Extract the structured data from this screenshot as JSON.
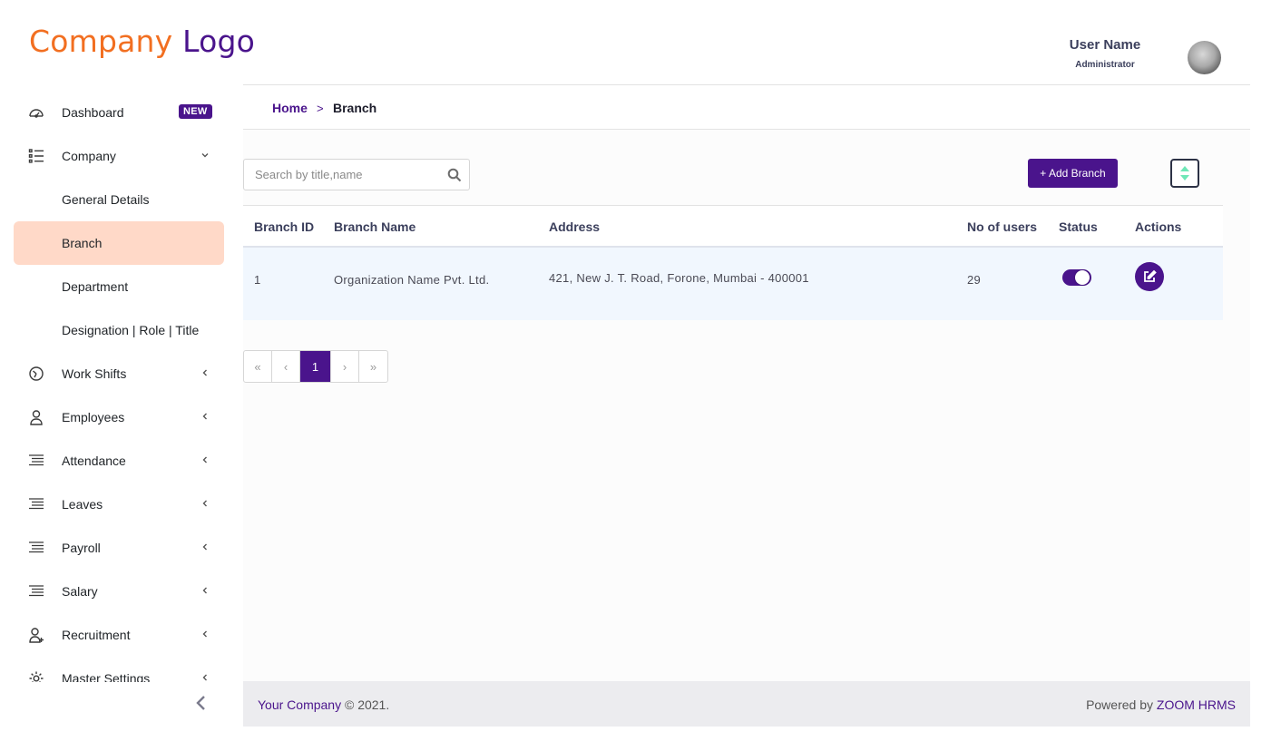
{
  "logo": {
    "part1": "Company",
    "part2": "Logo"
  },
  "user": {
    "name": "User Name",
    "role": "Administrator"
  },
  "colors": {
    "primary": "#4a148c",
    "accent": "#f26f21",
    "active_nav": "#ffd9c8"
  },
  "sidebar": {
    "items": [
      {
        "label": "Dashboard",
        "icon": "dashboard-icon",
        "badge": "NEW"
      },
      {
        "label": "Company",
        "icon": "list-icon",
        "chevron": "chevron-down-icon"
      },
      {
        "label": "General Details"
      },
      {
        "label": "Branch",
        "active": true
      },
      {
        "label": "Department"
      },
      {
        "label": "Designation | Role | Title"
      },
      {
        "label": "Work Shifts",
        "icon": "clock-icon",
        "chevron": "chevron-left-icon"
      },
      {
        "label": "Employees",
        "icon": "user-icon",
        "chevron": "chevron-left-icon"
      },
      {
        "label": "Attendance",
        "icon": "lines-icon",
        "chevron": "chevron-left-icon"
      },
      {
        "label": "Leaves",
        "icon": "lines-icon",
        "chevron": "chevron-left-icon"
      },
      {
        "label": "Payroll",
        "icon": "lines-icon",
        "chevron": "chevron-left-icon"
      },
      {
        "label": "Salary",
        "icon": "lines-icon",
        "chevron": "chevron-left-icon"
      },
      {
        "label": "Recruitment",
        "icon": "user-plus-icon",
        "chevron": "chevron-left-icon"
      },
      {
        "label": "Master Settings",
        "icon": "gear-icon",
        "chevron": "chevron-left-icon"
      }
    ]
  },
  "breadcrumb": {
    "home": "Home",
    "separator": ">",
    "current": "Branch"
  },
  "search": {
    "placeholder": "Search by title,name",
    "value": ""
  },
  "toolbar": {
    "add_label": "+ Add Branch"
  },
  "table": {
    "headers": {
      "id": "Branch ID",
      "name": "Branch Name",
      "address": "Address",
      "users": "No of users",
      "status": "Status",
      "actions": "Actions"
    },
    "rows": [
      {
        "id": "1",
        "name": "Organization Name Pvt. Ltd.",
        "address": "421, New J. T. Road, Forone, Mumbai - 400001",
        "users": "29",
        "status_on": true
      }
    ]
  },
  "pagination": {
    "first": "«",
    "prev": "‹",
    "current": "1",
    "next": "›",
    "last": "»"
  },
  "footer": {
    "company": "Your Company",
    "copyright": "© 2021.",
    "powered_prefix": "Powered by",
    "powered_brand": "ZOOM HRMS"
  }
}
